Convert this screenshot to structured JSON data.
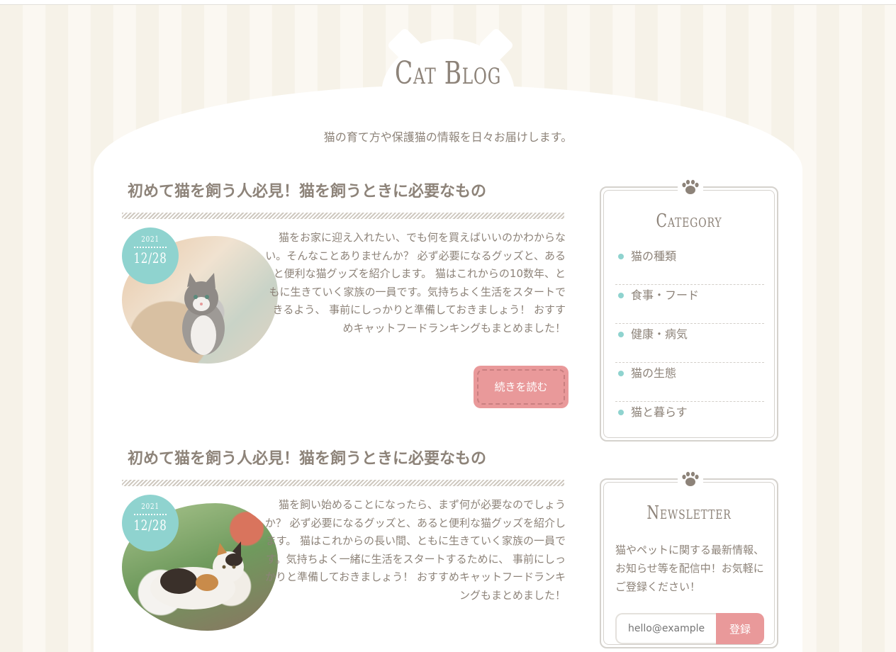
{
  "site": {
    "title": "Cat Blog",
    "description": "猫の育て方や保護猫の情報を日々お届けします。"
  },
  "posts": [
    {
      "title": "初めて猫を飼う人必見！猫を飼うときに必要なもの",
      "date_year": "2021",
      "date_md": "12/28",
      "excerpt": "猫をお家に迎え入れたい、でも何を買えばいいのかわからない。そんなことありませんか？ 必ず必要になるグッズと、あると便利な猫グッズを紹介します。 猫はこれからの10数年、ともに生きていく家族の一員です。気持ちよく生活をスタートできるよう、 事前にしっかりと準備しておきましょう！ おすすめキャットフードランキングもまとめました！",
      "readmore": "続きを読む"
    },
    {
      "title": "初めて猫を飼う人必見！猫を飼うときに必要なもの",
      "date_year": "2021",
      "date_md": "12/28",
      "excerpt": "猫を飼い始めることになったら、まず何が必要なのでしょうか？ 必ず必要になるグッズと、あると便利な猫グッズを紹介します。 猫はこれからの長い間、ともに生きていく家族の一員です。気持ちよく一緒に生活をスタートするために、 事前にしっかりと準備しておきましょう！ おすすめキャットフードランキングもまとめました！"
    }
  ],
  "sidebar": {
    "category": {
      "title": "Category",
      "items": [
        "猫の種類",
        "食事・フード",
        "健康・病気",
        "猫の生態",
        "猫と暮らす"
      ]
    },
    "newsletter": {
      "title": "Newsletter",
      "text": "猫やペットに関する最新情報、お知らせ等を配信中！お気軽にご登録ください！",
      "placeholder": "hello@example",
      "button": "登録"
    }
  },
  "colors": {
    "accent_teal": "#8fd3cf",
    "accent_pink": "#e9999a",
    "text": "#8d8379"
  }
}
